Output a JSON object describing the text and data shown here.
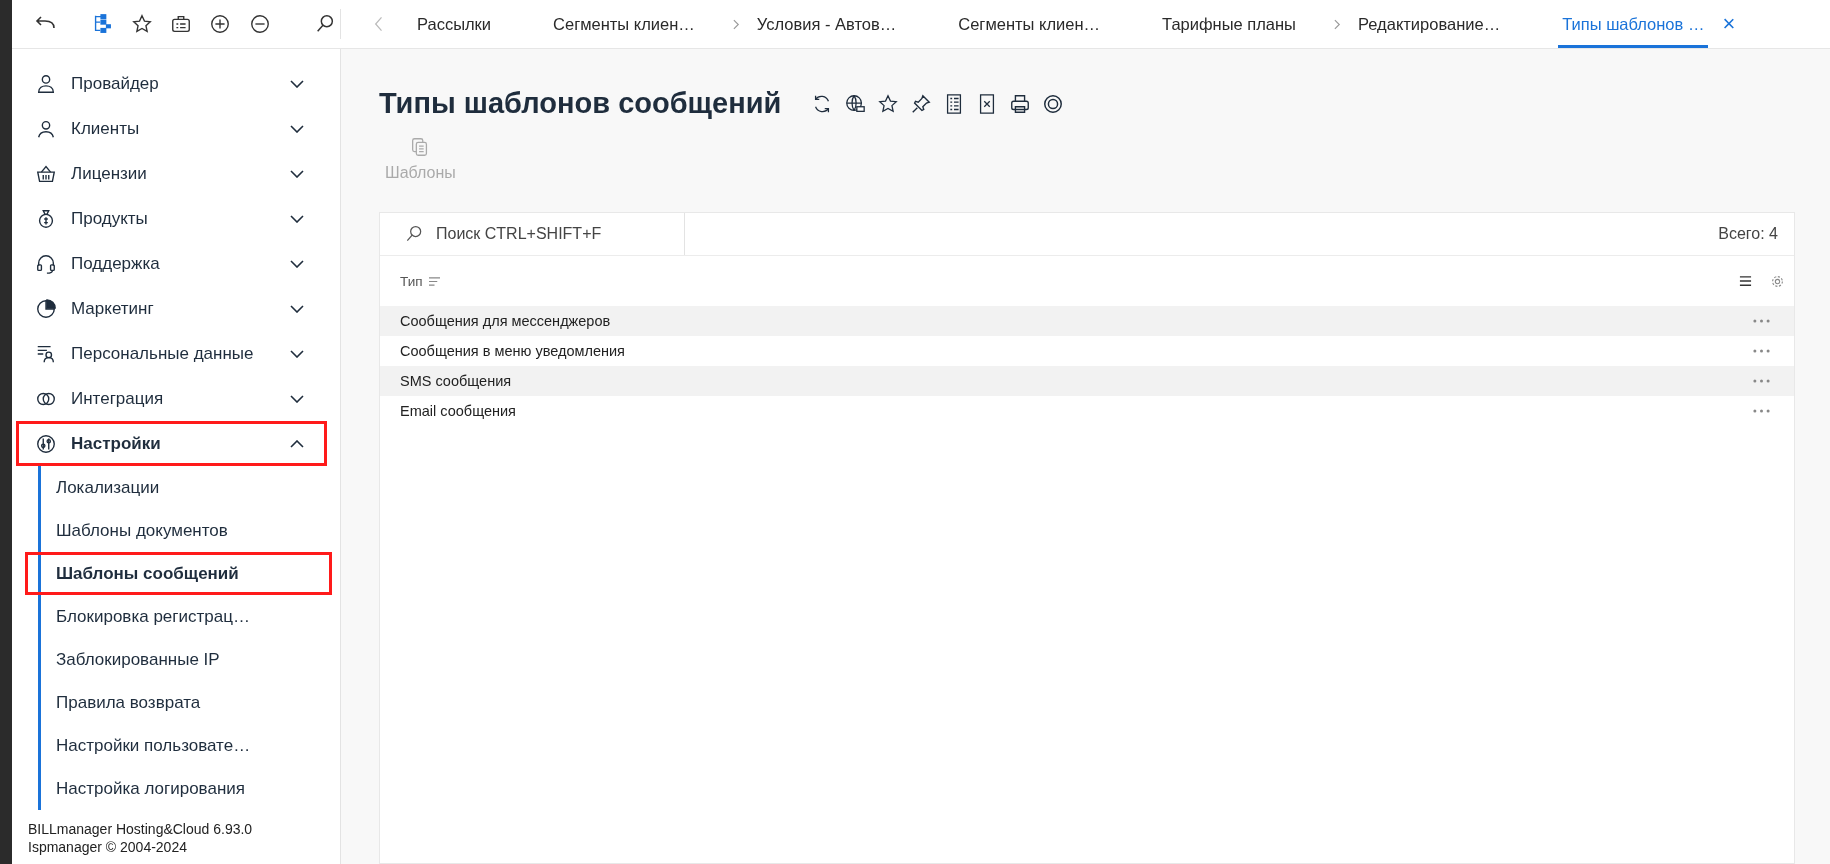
{
  "tabs": [
    {
      "label": "Рассылки",
      "selected": false,
      "chevron": false
    },
    {
      "label": "Сегменты клиен…",
      "selected": false,
      "chevron": false
    },
    {
      "label": "Условия - Автов…",
      "selected": false,
      "chevron": true
    },
    {
      "label": "Сегменты клиен…",
      "selected": false,
      "chevron": false
    },
    {
      "label": "Тарифные планы",
      "selected": false,
      "chevron": false
    },
    {
      "label": "Редактирование…",
      "selected": false,
      "chevron": true
    },
    {
      "label": "Типы шаблонов …",
      "selected": true,
      "chevron": false
    }
  ],
  "close_tab": "×",
  "sidebar": {
    "items": [
      {
        "label": "Провайдер",
        "expanded": false,
        "highlighted": false
      },
      {
        "label": "Клиенты",
        "expanded": false,
        "highlighted": false
      },
      {
        "label": "Лицензии",
        "expanded": false,
        "highlighted": false
      },
      {
        "label": "Продукты",
        "expanded": false,
        "highlighted": false
      },
      {
        "label": "Поддержка",
        "expanded": false,
        "highlighted": false
      },
      {
        "label": "Маркетинг",
        "expanded": false,
        "highlighted": false
      },
      {
        "label": "Персональные данные",
        "expanded": false,
        "highlighted": false
      },
      {
        "label": "Интеграция",
        "expanded": false,
        "highlighted": false
      },
      {
        "label": "Настройки",
        "expanded": true,
        "highlighted": true,
        "children": [
          {
            "label": "Локализации",
            "selected": false,
            "highlighted": false
          },
          {
            "label": "Шаблоны документов",
            "selected": false,
            "highlighted": false
          },
          {
            "label": "Шаблоны сообщений",
            "selected": true,
            "highlighted": true
          },
          {
            "label": "Блокировка регистрац…",
            "selected": false,
            "highlighted": false
          },
          {
            "label": "Заблокированные IP",
            "selected": false,
            "highlighted": false
          },
          {
            "label": "Правила возврата",
            "selected": false,
            "highlighted": false
          },
          {
            "label": "Настройки пользовате…",
            "selected": false,
            "highlighted": false
          },
          {
            "label": "Настройка логирования",
            "selected": false,
            "highlighted": false
          }
        ]
      }
    ],
    "footer": [
      "BILLmanager Hosting&Cloud 6.93.0",
      "Ispmanager © 2004-2024"
    ]
  },
  "page": {
    "title": "Типы шаблонов сообщений",
    "actions": [
      {
        "label": "Шаблоны",
        "disabled": true
      }
    ]
  },
  "table": {
    "search": {
      "placeholder": "Поиск CTRL+SHIFT+F"
    },
    "total": "Всего: 4",
    "columns": [
      "Тип"
    ],
    "rows": [
      {
        "cells": [
          "Сообщения для мессенджеров"
        ]
      },
      {
        "cells": [
          "Сообщения в меню уведомления"
        ]
      },
      {
        "cells": [
          "SMS сообщения"
        ]
      },
      {
        "cells": [
          "Email сообщения"
        ]
      }
    ]
  }
}
